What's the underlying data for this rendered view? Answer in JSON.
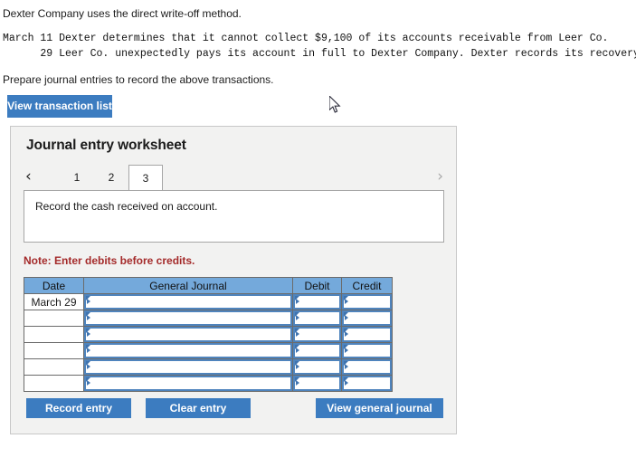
{
  "intro": {
    "line1": "Dexter Company uses the direct write-off method.",
    "transactions": "March 11 Dexter determines that it cannot collect $9,100 of its accounts receivable from Leer Co.\n      29 Leer Co. unexpectedly pays its account in full to Dexter Company. Dexter records its recovery of this bad debt.",
    "prepare": "Prepare journal entries to record the above transactions."
  },
  "toolbar": {
    "view_transaction_list": "View transaction list"
  },
  "worksheet": {
    "title": "Journal entry worksheet",
    "prev_icon": "‹",
    "next_icon": "›",
    "tabs": [
      {
        "label": "1",
        "selected": false
      },
      {
        "label": "2",
        "selected": false
      },
      {
        "label": "3",
        "selected": true
      }
    ],
    "description": "Record the cash received on account.",
    "note": "Note: Enter debits before credits.",
    "table": {
      "headers": [
        "Date",
        "General Journal",
        "Debit",
        "Credit"
      ],
      "rows": [
        {
          "date": "March 29",
          "general_journal": "",
          "debit": "",
          "credit": ""
        },
        {
          "date": "",
          "general_journal": "",
          "debit": "",
          "credit": ""
        },
        {
          "date": "",
          "general_journal": "",
          "debit": "",
          "credit": ""
        },
        {
          "date": "",
          "general_journal": "",
          "debit": "",
          "credit": ""
        },
        {
          "date": "",
          "general_journal": "",
          "debit": "",
          "credit": ""
        },
        {
          "date": "",
          "general_journal": "",
          "debit": "",
          "credit": ""
        }
      ]
    },
    "buttons": {
      "record_entry": "Record entry",
      "clear_entry": "Clear entry",
      "view_general_journal": "View general journal"
    }
  },
  "colors": {
    "accent_blue": "#3c7cc0",
    "header_blue": "#74a9db",
    "field_border_blue": "#4f84bd",
    "note_red": "#a42a2a",
    "panel_bg": "#f2f2f1"
  }
}
